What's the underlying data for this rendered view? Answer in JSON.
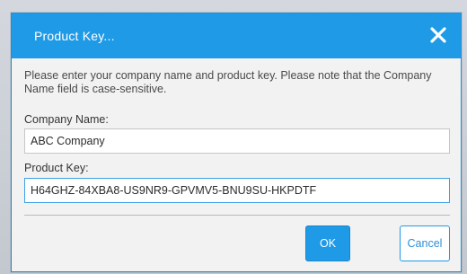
{
  "dialog": {
    "title": "Product Key...",
    "close_icon": "close-icon",
    "instructions": "Please enter your company name and product key.  Please note that the Company Name field is case-sensitive.",
    "company_label": "Company Name:",
    "company_value": "ABC Company",
    "product_label": "Product Key:",
    "product_value": "H64GHZ-84XBA8-US9NR9-GPVMV5-BNU9SU-HKPDTF",
    "ok_label": "OK",
    "cancel_label": "Cancel"
  },
  "colors": {
    "accent": "#1f9ae6",
    "background": "#f2f2f2",
    "text": "#333333"
  }
}
